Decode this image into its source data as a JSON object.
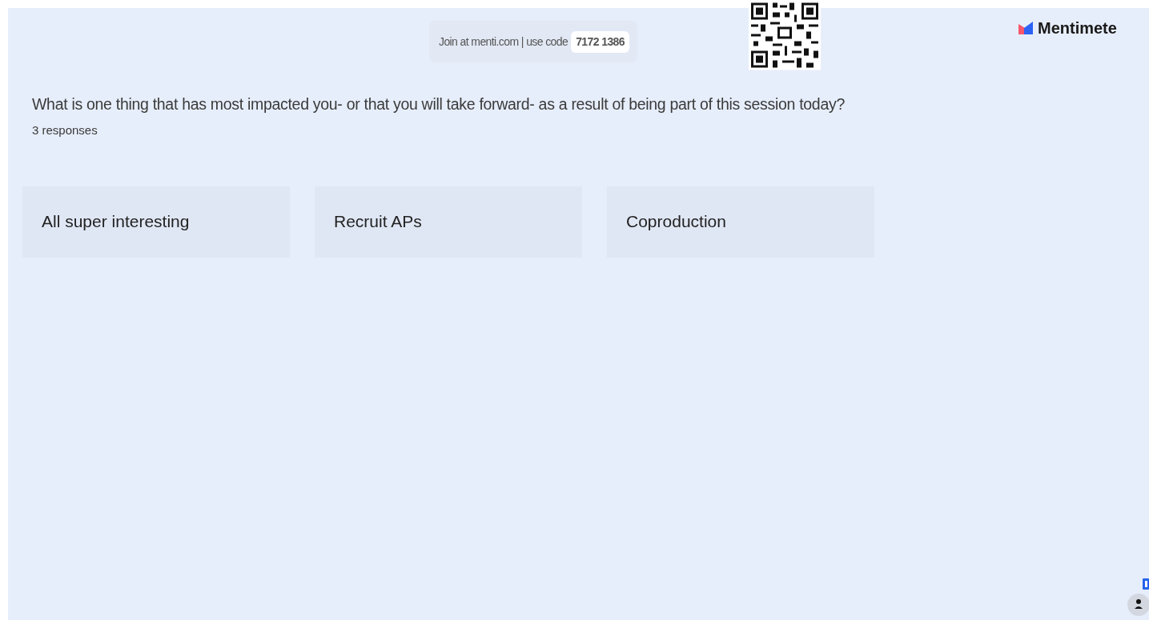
{
  "join_bar": {
    "text": "Join at menti.com | use code",
    "code": "7172 1386"
  },
  "brand": {
    "name": "Mentimete"
  },
  "question": "What is one thing that has most impacted you- or that you will take forward- as a result of being part of this session today?",
  "response_count": "3 responses",
  "responses": [
    {
      "text": "All super interesting"
    },
    {
      "text": "Recruit APs"
    },
    {
      "text": "Coproduction"
    }
  ]
}
